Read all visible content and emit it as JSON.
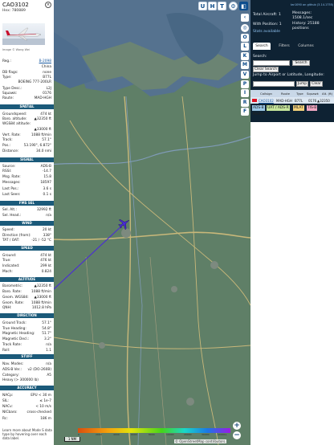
{
  "aircraft": {
    "callsign": "CAO3102",
    "hex_label": "Hex:",
    "hex": "780889",
    "photo_credit": "Image © Wang Wei",
    "reg_label": "Reg.:",
    "reg": "B-2098",
    "country": "China",
    "db_flags_label": "DB flags:",
    "db_flags": "none",
    "type_label": "Type:",
    "type": "B77L",
    "model": "BOEING 777-200LR",
    "type_desc_label": "Type Desc.:",
    "type_desc": "L2J",
    "squawk_label": "Squawk:",
    "squawk": "0176",
    "route_label": "Route:",
    "route": "MAD-HGH"
  },
  "sections": {
    "spatial": "SPATIAL",
    "signal": "SIGNAL",
    "fms": "FMS SEL",
    "wind": "WIND",
    "speed": "SPEED",
    "altitude": "ALTITUDE",
    "direction": "DIRECTION",
    "stuff": "STUFF",
    "accuracy": "ACCURACY"
  },
  "spatial": [
    {
      "k": "Groundspeed:",
      "v": "474 kt"
    },
    {
      "k": "Baro. altitude:",
      "v": "▲32350 ft"
    },
    {
      "k": "WGS84 altitude:",
      "v": ""
    },
    {
      "k": "",
      "v": "▲33000 ft"
    },
    {
      "k": "Vert. Rate:",
      "v": "1088 ft/min"
    },
    {
      "k": "Track:",
      "v": "57.1°"
    },
    {
      "k": "Pos.:",
      "v": "53.190°, 6.872°"
    },
    {
      "k": "Distance:",
      "v": "34.0 nmi"
    }
  ],
  "signal": [
    {
      "k": "Source:",
      "v": "ADS-B"
    },
    {
      "k": "RSSI:",
      "v": "-14.7"
    },
    {
      "k": "Msg. Rate:",
      "v": "15.8"
    },
    {
      "k": "Messages:",
      "v": "18597"
    },
    {
      "k": "Last Pos.:",
      "v": "3.6 s"
    },
    {
      "k": "Last Seen:",
      "v": "0.1 s"
    }
  ],
  "fms": [
    {
      "k": "Sel. Alt.:",
      "v": "32992 ft"
    },
    {
      "k": "Sel. Head.:",
      "v": "n/a"
    }
  ],
  "wind": [
    {
      "k": "Speed:",
      "v": "20 kt"
    },
    {
      "k": "Direction (from):",
      "v": "338°"
    },
    {
      "k": "TAT / OAT:",
      "v": "-21 / -52 °C"
    }
  ],
  "speed": [
    {
      "k": "Ground:",
      "v": "474 kt"
    },
    {
      "k": "True:",
      "v": "476 kt"
    },
    {
      "k": "Indicated:",
      "v": "299 kt"
    },
    {
      "k": "Mach:",
      "v": "0.824"
    }
  ],
  "altitude": [
    {
      "k": "Barometric:",
      "v": "▲32350 ft"
    },
    {
      "k": "Baro. Rate:",
      "v": "1088 ft/min"
    },
    {
      "k": "Geom. WGS84:",
      "v": "▲33000 ft"
    },
    {
      "k": "Geom. Rate:",
      "v": "1088 ft/min"
    },
    {
      "k": "QNH:",
      "v": "1012.8 hPa"
    }
  ],
  "direction": [
    {
      "k": "Ground Track:",
      "v": "57.1°"
    },
    {
      "k": "True Heading:",
      "v": "54.8°"
    },
    {
      "k": "Magnetic Heading:",
      "v": "51.7°"
    },
    {
      "k": "Magnetic Decl.:",
      "v": "3.2°"
    },
    {
      "k": "Track Rate:",
      "v": "n/a"
    },
    {
      "k": "Roll:",
      "v": "1.1"
    }
  ],
  "stuff": [
    {
      "k": "Nav. Modes:",
      "v": "n/a"
    },
    {
      "k": "ADS-B Ver.:",
      "v": "v2 (DO-260B)"
    },
    {
      "k": "Category:",
      "v": "A5"
    },
    {
      "k": "Heavy (> 300000 lb)",
      "v": ""
    }
  ],
  "accuracy": [
    {
      "k": "NACp:",
      "v": "EPU < 30 m"
    },
    {
      "k": "SIL:",
      "v": "≤ 1e-7"
    },
    {
      "k": "NACv:",
      "v": "< 10 m/s"
    },
    {
      "k": "NICbaro:",
      "v": "cross-checked"
    },
    {
      "k": "Rc:",
      "v": "186 m"
    }
  ],
  "note": "Learn more about Mode S data type by hovering over each data label.",
  "right_panel": {
    "link": "tar1090 on github (3.14.1755)",
    "total_aircraft": "Total Aircraft: 1",
    "with_position": "With Position: 1",
    "stats_available": "Stats available",
    "messages": "Messages: 1508.1/sec",
    "history": "History: 25188 positions",
    "tabs": [
      "Search",
      "Filters",
      "Columns"
    ],
    "search_label": "Search:",
    "search_button": "Search",
    "clear_search": "Clear Search",
    "jump_label": "Jump to Airport or Latitude, Longitude:",
    "jump_button": "Jump",
    "clear_button": "Clear",
    "table_headers": [
      "Callsign",
      "Route",
      "Type",
      "Squawk",
      "Alt. (ft)"
    ],
    "row": {
      "callsign": "CAO3102",
      "route": "MAD-HGH",
      "type": "B77L",
      "squawk": "0176",
      "alt": "▲32350"
    },
    "pills": [
      {
        "label": "ADS-B",
        "color": "#9cc7e6"
      },
      {
        "label": "UAT / ADS-R",
        "color": "#c7e69c"
      },
      {
        "label": "MLAT",
        "color": "#f2d07a"
      },
      {
        "label": "TIS-B",
        "color": "#f2a7c3"
      }
    ],
    "mode_s": "Mode-S"
  },
  "map": {
    "top_buttons": [
      "U",
      "H",
      "T"
    ],
    "right_buttons": [
      "O",
      "L",
      "K",
      "M",
      "V",
      "P",
      "I",
      "R",
      "F"
    ],
    "zoom_in": "+",
    "zoom_out": "−",
    "scale": "1 NM",
    "attribution": "© OpenStreetMap contributors.",
    "legend_labels": [
      "0",
      "2000",
      "4000",
      "6000",
      "8000",
      "10000",
      "20000",
      "30000",
      "40000+"
    ],
    "colors": {
      "track": "#4a2ad8",
      "water": "#4b6f9e",
      "land": "#5f7f67",
      "roads": "#c9b87a"
    }
  }
}
